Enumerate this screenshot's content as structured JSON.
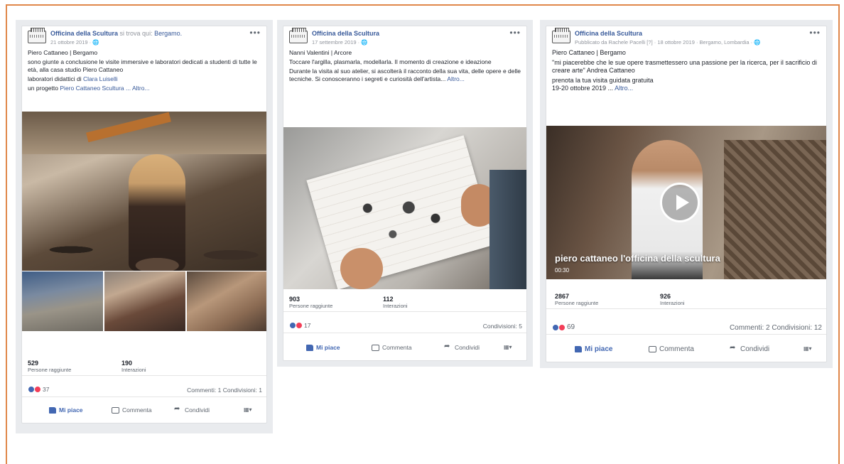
{
  "posts": [
    {
      "page_name": "Officina della Scultura",
      "location_prefix": "si trova qui:",
      "location": "Bergamo.",
      "date": "21 ottobre 2019 · ",
      "lines": [
        "Piero Cattaneo | Bergamo",
        "sono giunte a conclusione le visite immersive e laboratori dedicati a studenti di tutte le età, alla casa studio Piero Cattaneo"
      ],
      "lab_prefix": "laboratori didattici di",
      "lab_author": "Clara Luiselli",
      "project_prefix": "un progetto",
      "project_author": "Piero Cattaneo Scultura",
      "more": "... Altro...",
      "reach_value": "529",
      "reach_label": "Persone raggiunte",
      "interactions_value": "190",
      "interactions_label": "Interazioni",
      "reactions": "37",
      "comments_shares": "Commenti: 1  Condivisioni: 1",
      "like_label": "Mi piace",
      "comment_label": "Commenta",
      "share_label": "Condividi"
    },
    {
      "page_name": "Officina della Scultura",
      "date": "17 settembre 2019 · ",
      "lines": [
        "Nanni Valentini | Arcore",
        "Toccare l'argilla, plasmarla, modellarla. Il momento di creazione e ideazione",
        "Durante la visita al suo atelier, si ascolterà il racconto della sua vita, delle opere e delle tecniche. Si conosceranno i segreti e curiosità dell'artista..."
      ],
      "more": "Altro...",
      "reach_value": "903",
      "reach_label": "Persone raggiunte",
      "interactions_value": "112",
      "interactions_label": "Interazioni",
      "reactions": "17",
      "comments_shares": "Condivisioni: 5",
      "like_label": "Mi piace",
      "comment_label": "Commenta",
      "share_label": "Condividi"
    },
    {
      "page_name": "Officina della Scultura",
      "date": "Pubblicato da Rachele Pacelli [?] · 18 ottobre 2019 · Bergamo, Lombardia · ",
      "lines": [
        "Piero Cattaneo | Bergamo",
        "\"mi piacerebbe che le sue opere trasmettessero una passione per la ricerca, per il sacrificio di creare arte\" Andrea Cattaneo",
        "prenota la tua visita guidata gratuita"
      ],
      "date_line": "19-20 ottobre 2019 ...",
      "more": "Altro...",
      "video_title": "piero cattaneo l'officina della scultura",
      "video_time": "00:30",
      "reach_value": "2867",
      "reach_label": "Persone raggiunte",
      "interactions_value": "926",
      "interactions_label": "Interazioni",
      "reactions": "69",
      "comments_shares": "Commenti: 2  Condivisioni: 12",
      "like_label": "Mi piace",
      "comment_label": "Commenta",
      "share_label": "Condividi"
    }
  ],
  "icons": {
    "more": "more-icon",
    "globe": "globe-icon",
    "like": "like-icon",
    "comment": "comment-icon",
    "share": "share-icon",
    "play": "play-icon"
  },
  "colors": {
    "frame_border": "#e0874a",
    "link_blue": "#365899",
    "like_blue": "#4267b2",
    "love_red": "#f33e58",
    "panel_bg": "#e9ebee"
  }
}
